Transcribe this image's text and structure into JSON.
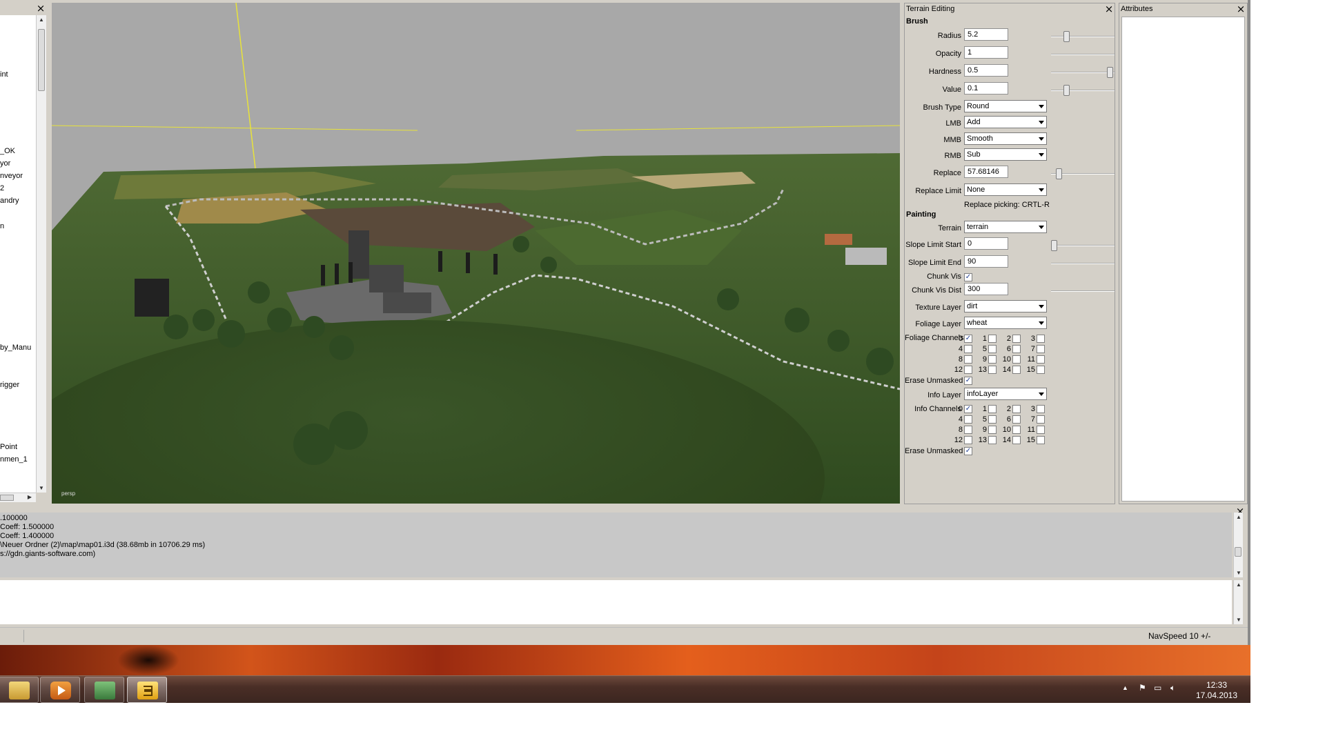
{
  "outliner": {
    "items": [
      "int",
      "_OK",
      "yor",
      "nveyor",
      "2",
      "andry",
      "n",
      "by_Manu",
      "rigger",
      "Point",
      "nmen_1"
    ]
  },
  "viewport": {
    "camera_label": "persp"
  },
  "terrain_panel": {
    "title": "Terrain Editing",
    "brush_section": "Brush",
    "radius": {
      "label": "Radius",
      "value": "5.2",
      "slider": 0.22
    },
    "opacity": {
      "label": "Opacity",
      "value": "1",
      "slider": null
    },
    "hardness": {
      "label": "Hardness",
      "value": "0.5",
      "slider": 0.97
    },
    "value": {
      "label": "Value",
      "value": "0.1",
      "slider": 0.22
    },
    "brush_type": {
      "label": "Brush Type",
      "value": "Round"
    },
    "lmb": {
      "label": "LMB",
      "value": "Add"
    },
    "mmb": {
      "label": "MMB",
      "value": "Smooth"
    },
    "rmb": {
      "label": "RMB",
      "value": "Sub"
    },
    "replace": {
      "label": "Replace",
      "value": "57.68146",
      "slider": 0.08
    },
    "replace_limit": {
      "label": "Replace Limit",
      "value": "None"
    },
    "replace_picking": "Replace picking: CRTL-R",
    "painting_section": "Painting",
    "terrain": {
      "label": "Terrain",
      "value": "terrain"
    },
    "slope_start": {
      "label": "Slope Limit Start",
      "value": "0",
      "slider": 0.0
    },
    "slope_end": {
      "label": "Slope Limit End",
      "value": "90",
      "slider": null
    },
    "chunk_vis": {
      "label": "Chunk Vis",
      "checked": true
    },
    "chunk_vis_dist": {
      "label": "Chunk Vis Dist",
      "value": "300",
      "slider": null
    },
    "texture_layer": {
      "label": "Texture Layer",
      "value": "dirt"
    },
    "foliage_layer": {
      "label": "Foliage Layer",
      "value": "wheat"
    },
    "foliage_channels": {
      "label": "Foliage Channels",
      "checked": [
        0
      ]
    },
    "erase_unmasked_1": {
      "label": "Erase Unmasked",
      "checked": true
    },
    "info_layer": {
      "label": "Info Layer",
      "value": "infoLayer"
    },
    "info_channels": {
      "label": "Info Channels",
      "checked": [
        0
      ]
    },
    "erase_unmasked_2": {
      "label": "Erase Unmasked",
      "checked": true
    },
    "channel_numbers": [
      "0",
      "1",
      "2",
      "3",
      "4",
      "5",
      "6",
      "7",
      "8",
      "9",
      "10",
      "11",
      "12",
      "13",
      "14",
      "15"
    ]
  },
  "attributes_panel": {
    "title": "Attributes"
  },
  "console": {
    "lines": [
      ".100000",
      "Coeff: 1.500000",
      "Coeff: 1.400000",
      "\\Neuer Ordner (2)\\map\\map01.i3d (38.68mb in 10706.29 ms)",
      "s://gdn.giants-software.com)"
    ]
  },
  "statusbar": {
    "nav_speed": "NavSpeed 10 +/-"
  },
  "taskbar": {
    "time": "12:33",
    "date": "17.04.2013",
    "buttons": [
      "explorer-icon",
      "media-player-icon",
      "network-users-icon",
      "giants-editor-icon"
    ]
  }
}
